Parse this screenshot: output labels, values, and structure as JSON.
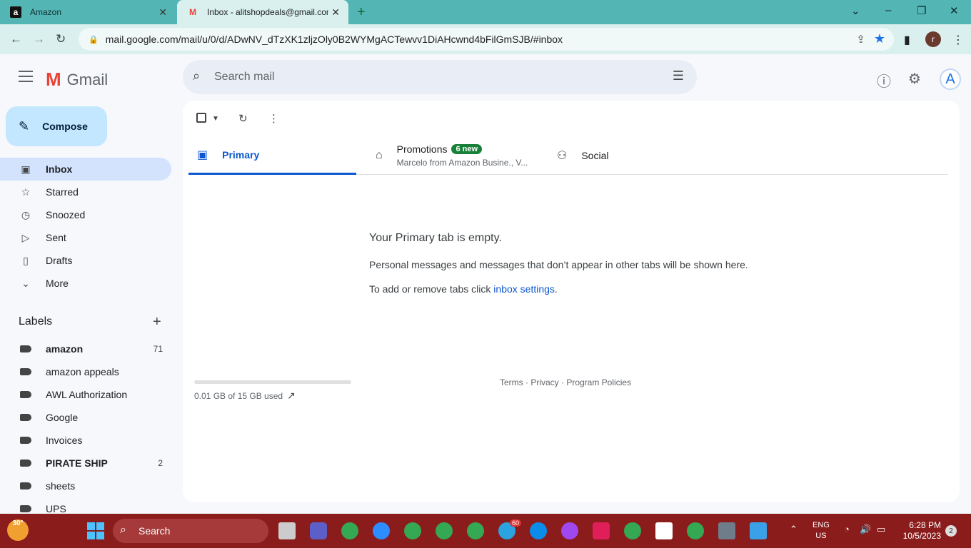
{
  "browser": {
    "tabs": [
      {
        "title": "Amazon",
        "favicon": "amazon-favicon"
      },
      {
        "title": "Inbox - alitshopdeals@gmail.com",
        "favicon": "gmail-favicon"
      }
    ],
    "url": "mail.google.com/mail/u/0/d/ADwNV_dTzXK1zljzOly0B2WYMgACTewvv1DiAHcwnd4bFilGmSJB/#inbox",
    "profile_initial": "r"
  },
  "gmail": {
    "logo_text": "Gmail",
    "search_placeholder": "Search mail",
    "account_initial": "A",
    "compose_label": "Compose",
    "nav": [
      {
        "label": "Inbox",
        "icon": "inbox-icon",
        "active": true
      },
      {
        "label": "Starred",
        "icon": "star-icon"
      },
      {
        "label": "Snoozed",
        "icon": "clock-icon"
      },
      {
        "label": "Sent",
        "icon": "send-icon"
      },
      {
        "label": "Drafts",
        "icon": "draft-icon"
      },
      {
        "label": "More",
        "icon": "chevron-down-icon"
      }
    ],
    "labels_title": "Labels",
    "labels": [
      {
        "name": "amazon",
        "count": "71",
        "bold": true
      },
      {
        "name": "amazon appeals",
        "count": ""
      },
      {
        "name": "AWL Authorization",
        "count": ""
      },
      {
        "name": "Google",
        "count": ""
      },
      {
        "name": "Invoices",
        "count": ""
      },
      {
        "name": "PIRATE SHIP",
        "count": "2",
        "bold": true
      },
      {
        "name": "sheets",
        "count": ""
      },
      {
        "name": "UPS",
        "count": ""
      }
    ],
    "tabs": {
      "primary": "Primary",
      "promotions": "Promotions",
      "promotions_badge": "6 new",
      "promotions_sub": "Marcelo from Amazon Busine., V...",
      "social": "Social"
    },
    "empty": {
      "heading": "Your Primary tab is empty.",
      "line1": "Personal messages and messages that don’t appear in other tabs will be shown here.",
      "line2_prefix": "To add or remove tabs click ",
      "line2_link": "inbox settings",
      "line2_suffix": "."
    },
    "storage_text": "0.01 GB of 15 GB used",
    "storage_used_fraction": 0.0007,
    "footer": "Terms · Privacy · Program Policies"
  },
  "taskbar": {
    "weather_temp": "30°",
    "search_label": "Search",
    "telegram_badge": "60",
    "lang_line1": "ENG",
    "lang_line2": "US",
    "time": "6:28 PM",
    "date": "10/5/2023",
    "notification_count": "2"
  },
  "colors": {
    "tabstrip": "#54b5b5",
    "compose_bg": "#c2e7ff",
    "active_nav": "#d3e3fd",
    "primary_accent": "#0b57d0",
    "badge_green": "#188038",
    "taskbar": "#8b1c1c"
  }
}
